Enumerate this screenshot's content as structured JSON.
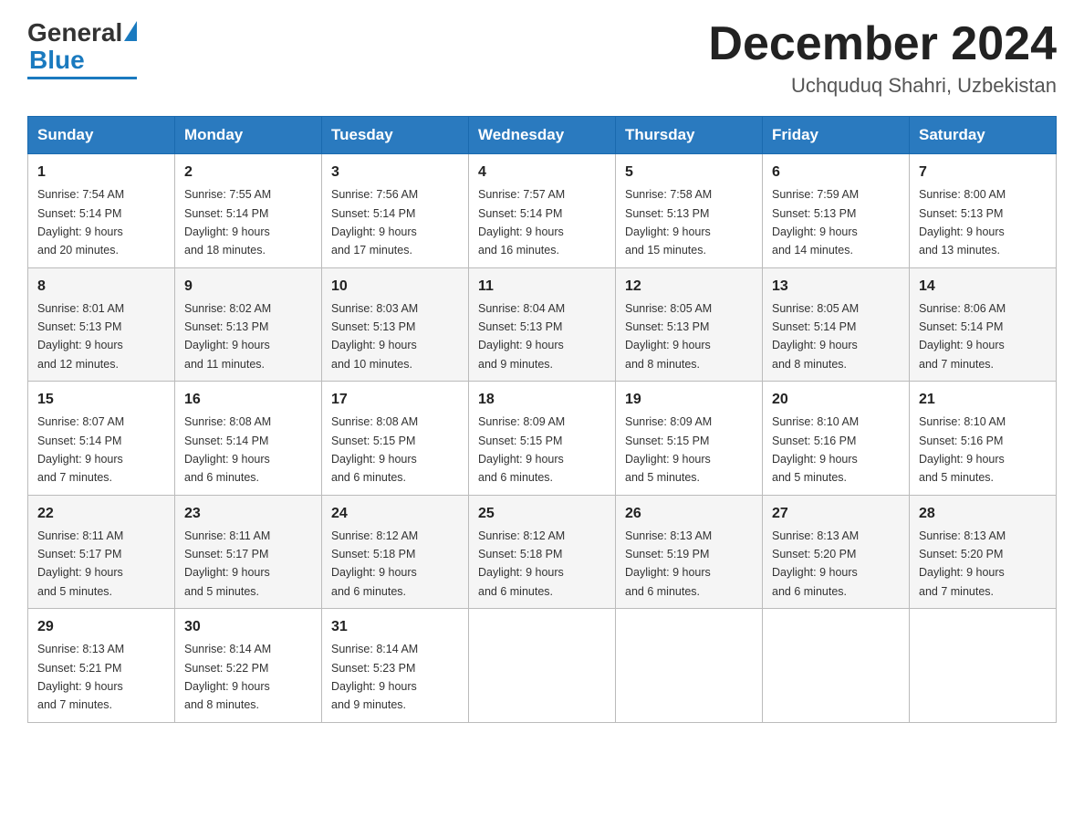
{
  "header": {
    "logo": {
      "general": "General",
      "blue": "Blue"
    },
    "title": "December 2024",
    "location": "Uchquduq Shahri, Uzbekistan"
  },
  "days_of_week": [
    "Sunday",
    "Monday",
    "Tuesday",
    "Wednesday",
    "Thursday",
    "Friday",
    "Saturday"
  ],
  "weeks": [
    [
      {
        "day": "1",
        "sunrise": "7:54 AM",
        "sunset": "5:14 PM",
        "daylight": "9 hours and 20 minutes."
      },
      {
        "day": "2",
        "sunrise": "7:55 AM",
        "sunset": "5:14 PM",
        "daylight": "9 hours and 18 minutes."
      },
      {
        "day": "3",
        "sunrise": "7:56 AM",
        "sunset": "5:14 PM",
        "daylight": "9 hours and 17 minutes."
      },
      {
        "day": "4",
        "sunrise": "7:57 AM",
        "sunset": "5:14 PM",
        "daylight": "9 hours and 16 minutes."
      },
      {
        "day": "5",
        "sunrise": "7:58 AM",
        "sunset": "5:13 PM",
        "daylight": "9 hours and 15 minutes."
      },
      {
        "day": "6",
        "sunrise": "7:59 AM",
        "sunset": "5:13 PM",
        "daylight": "9 hours and 14 minutes."
      },
      {
        "day": "7",
        "sunrise": "8:00 AM",
        "sunset": "5:13 PM",
        "daylight": "9 hours and 13 minutes."
      }
    ],
    [
      {
        "day": "8",
        "sunrise": "8:01 AM",
        "sunset": "5:13 PM",
        "daylight": "9 hours and 12 minutes."
      },
      {
        "day": "9",
        "sunrise": "8:02 AM",
        "sunset": "5:13 PM",
        "daylight": "9 hours and 11 minutes."
      },
      {
        "day": "10",
        "sunrise": "8:03 AM",
        "sunset": "5:13 PM",
        "daylight": "9 hours and 10 minutes."
      },
      {
        "day": "11",
        "sunrise": "8:04 AM",
        "sunset": "5:13 PM",
        "daylight": "9 hours and 9 minutes."
      },
      {
        "day": "12",
        "sunrise": "8:05 AM",
        "sunset": "5:13 PM",
        "daylight": "9 hours and 8 minutes."
      },
      {
        "day": "13",
        "sunrise": "8:05 AM",
        "sunset": "5:14 PM",
        "daylight": "9 hours and 8 minutes."
      },
      {
        "day": "14",
        "sunrise": "8:06 AM",
        "sunset": "5:14 PM",
        "daylight": "9 hours and 7 minutes."
      }
    ],
    [
      {
        "day": "15",
        "sunrise": "8:07 AM",
        "sunset": "5:14 PM",
        "daylight": "9 hours and 7 minutes."
      },
      {
        "day": "16",
        "sunrise": "8:08 AM",
        "sunset": "5:14 PM",
        "daylight": "9 hours and 6 minutes."
      },
      {
        "day": "17",
        "sunrise": "8:08 AM",
        "sunset": "5:15 PM",
        "daylight": "9 hours and 6 minutes."
      },
      {
        "day": "18",
        "sunrise": "8:09 AM",
        "sunset": "5:15 PM",
        "daylight": "9 hours and 6 minutes."
      },
      {
        "day": "19",
        "sunrise": "8:09 AM",
        "sunset": "5:15 PM",
        "daylight": "9 hours and 5 minutes."
      },
      {
        "day": "20",
        "sunrise": "8:10 AM",
        "sunset": "5:16 PM",
        "daylight": "9 hours and 5 minutes."
      },
      {
        "day": "21",
        "sunrise": "8:10 AM",
        "sunset": "5:16 PM",
        "daylight": "9 hours and 5 minutes."
      }
    ],
    [
      {
        "day": "22",
        "sunrise": "8:11 AM",
        "sunset": "5:17 PM",
        "daylight": "9 hours and 5 minutes."
      },
      {
        "day": "23",
        "sunrise": "8:11 AM",
        "sunset": "5:17 PM",
        "daylight": "9 hours and 5 minutes."
      },
      {
        "day": "24",
        "sunrise": "8:12 AM",
        "sunset": "5:18 PM",
        "daylight": "9 hours and 6 minutes."
      },
      {
        "day": "25",
        "sunrise": "8:12 AM",
        "sunset": "5:18 PM",
        "daylight": "9 hours and 6 minutes."
      },
      {
        "day": "26",
        "sunrise": "8:13 AM",
        "sunset": "5:19 PM",
        "daylight": "9 hours and 6 minutes."
      },
      {
        "day": "27",
        "sunrise": "8:13 AM",
        "sunset": "5:20 PM",
        "daylight": "9 hours and 6 minutes."
      },
      {
        "day": "28",
        "sunrise": "8:13 AM",
        "sunset": "5:20 PM",
        "daylight": "9 hours and 7 minutes."
      }
    ],
    [
      {
        "day": "29",
        "sunrise": "8:13 AM",
        "sunset": "5:21 PM",
        "daylight": "9 hours and 7 minutes."
      },
      {
        "day": "30",
        "sunrise": "8:14 AM",
        "sunset": "5:22 PM",
        "daylight": "9 hours and 8 minutes."
      },
      {
        "day": "31",
        "sunrise": "8:14 AM",
        "sunset": "5:23 PM",
        "daylight": "9 hours and 9 minutes."
      },
      null,
      null,
      null,
      null
    ]
  ],
  "labels": {
    "sunrise": "Sunrise:",
    "sunset": "Sunset:",
    "daylight": "Daylight:"
  }
}
